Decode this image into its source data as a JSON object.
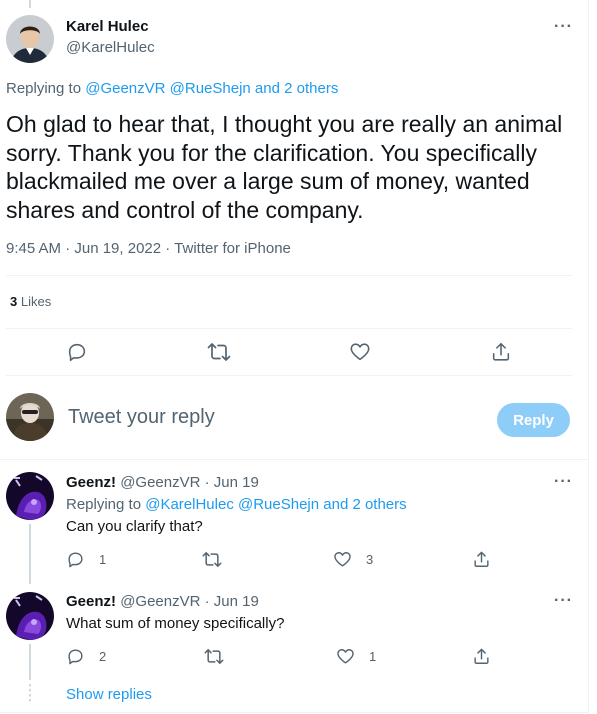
{
  "main_tweet": {
    "display_name": "Karel Hulec",
    "handle": "@KarelHulec",
    "replying_prefix": "Replying to",
    "replying_mentions": "@GeenzVR @RueShejn and 2 others",
    "text": "Oh glad to hear that, I thought you are really an animal sorry. Thank you for the clarification. You specifically blackmailed me over a large sum of money, wanted shares and control of the company.",
    "meta": "9:45 AM · Jun 19, 2022 · Twitter for iPhone",
    "likes_count": "3",
    "likes_label": "Likes",
    "more": "···"
  },
  "compose": {
    "placeholder": "Tweet your reply",
    "reply_button": "Reply"
  },
  "replies": [
    {
      "display_name": "Geenz!",
      "handle_date": "@GeenzVR · Jun 19",
      "replying_prefix": "Replying to",
      "replying_mentions": "@KarelHulec @RueShejn and 2 others",
      "text": "Can you clarify that?",
      "reply_count": "1",
      "like_count": "3",
      "more": "···"
    },
    {
      "display_name": "Geenz!",
      "handle_date": "@GeenzVR · Jun 19",
      "text": "What sum of money specifically?",
      "reply_count": "2",
      "like_count": "1",
      "more": "···"
    }
  ],
  "show_replies": "Show replies",
  "colors": {
    "accent": "#1d9bf0",
    "reply_button_bg": "#8ecdf7",
    "muted": "#536471",
    "text": "#0f1419"
  }
}
